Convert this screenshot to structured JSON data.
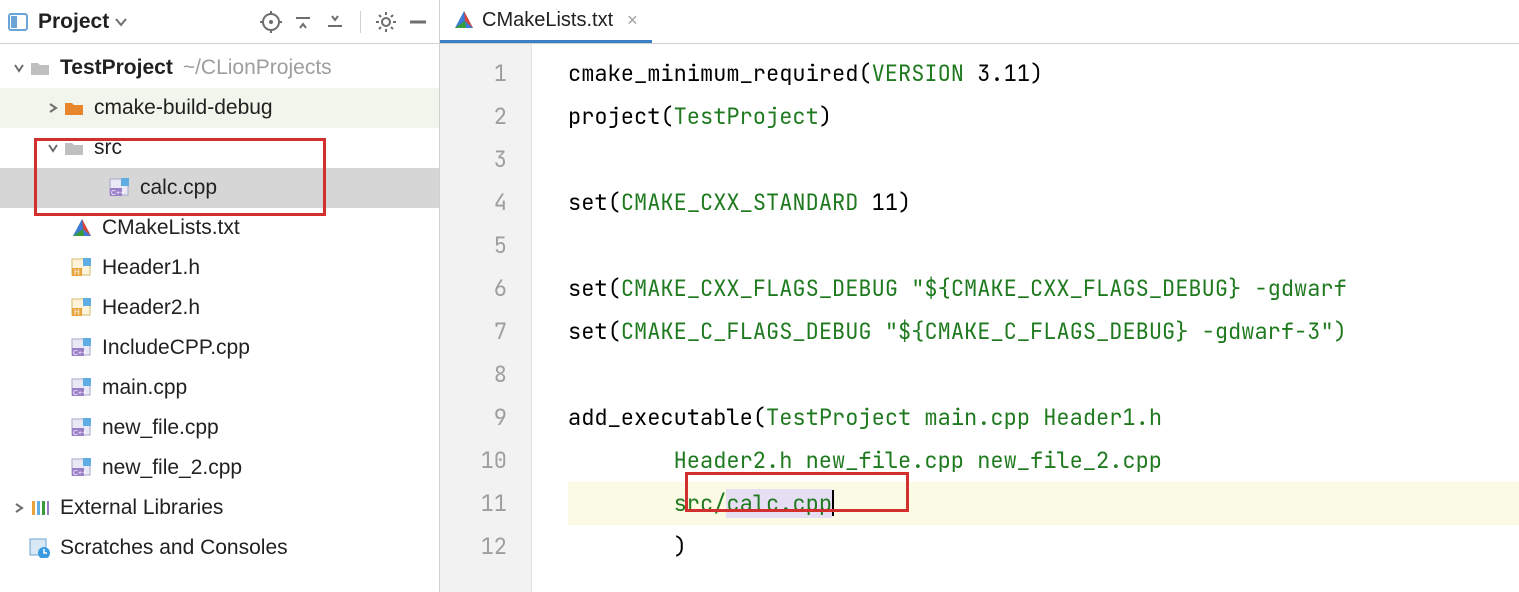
{
  "sidebar": {
    "title": "Project",
    "root": {
      "name": "TestProject",
      "path": "~/CLionProjects"
    },
    "items": [
      {
        "label": "cmake-build-debug"
      },
      {
        "label": "src"
      },
      {
        "label": "calc.cpp"
      },
      {
        "label": "CMakeLists.txt"
      },
      {
        "label": "Header1.h"
      },
      {
        "label": "Header2.h"
      },
      {
        "label": "IncludeCPP.cpp"
      },
      {
        "label": "main.cpp"
      },
      {
        "label": "new_file.cpp"
      },
      {
        "label": "new_file_2.cpp"
      }
    ],
    "external": "External Libraries",
    "scratches": "Scratches and Consoles"
  },
  "tab": {
    "label": "CMakeLists.txt"
  },
  "code": {
    "lines": [
      "1",
      "2",
      "3",
      "4",
      "5",
      "6",
      "7",
      "8",
      "9",
      "10",
      "11",
      "12"
    ],
    "l1_a": "cmake_minimum_required(",
    "l1_b": "VERSION",
    "l1_c": " 3.11)",
    "l2_a": "project(",
    "l2_b": "TestProject",
    "l2_c": ")",
    "l4_a": "set(",
    "l4_b": "CMAKE_CXX_STANDARD",
    "l4_c": " 11)",
    "l6_a": "set(",
    "l6_b": "CMAKE_CXX_FLAGS_DEBUG",
    "l6_c": " ",
    "l6_d": "\"${",
    "l6_e": "CMAKE_CXX_FLAGS_DEBUG",
    "l6_f": "} -gdwarf",
    "l7_a": "set(",
    "l7_b": "CMAKE_C_FLAGS_DEBUG",
    "l7_c": " ",
    "l7_d": "\"${",
    "l7_e": "CMAKE_C_FLAGS_DEBUG",
    "l7_f": "} -gdwarf-3\")",
    "l9_a": "add_executable(",
    "l9_b": "TestProject",
    "l9_c": " main.cpp Header1.h",
    "l10": "        Header2.h new_file.cpp new_file_2.cpp",
    "l11_a": "        ",
    "l11_b": "src/",
    "l11_c": "calc.cpp",
    "l12": "        )"
  }
}
